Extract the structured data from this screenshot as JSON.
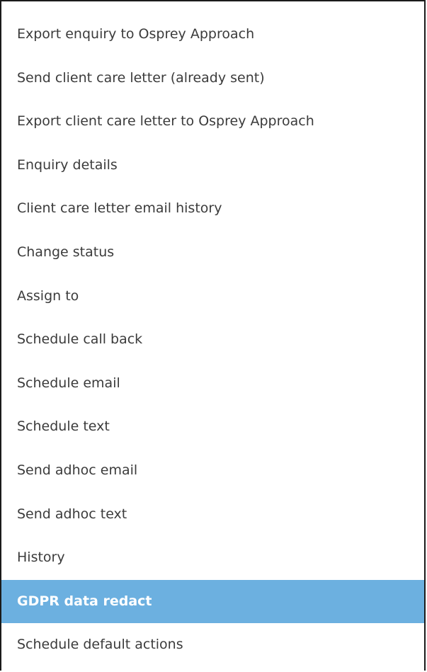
{
  "menu": {
    "active_index": 13,
    "active_color": "#6cb0e0",
    "items": [
      {
        "label": "Export enquiry to Osprey Approach"
      },
      {
        "label": "Send client care letter (already sent)"
      },
      {
        "label": "Export client care letter to Osprey Approach"
      },
      {
        "label": "Enquiry details"
      },
      {
        "label": "Client care letter email history"
      },
      {
        "label": "Change status"
      },
      {
        "label": "Assign to"
      },
      {
        "label": "Schedule call back"
      },
      {
        "label": "Schedule email"
      },
      {
        "label": "Schedule text"
      },
      {
        "label": "Send adhoc email"
      },
      {
        "label": "Send adhoc text"
      },
      {
        "label": "History"
      },
      {
        "label": "GDPR data redact"
      },
      {
        "label": "Schedule default actions"
      }
    ]
  }
}
